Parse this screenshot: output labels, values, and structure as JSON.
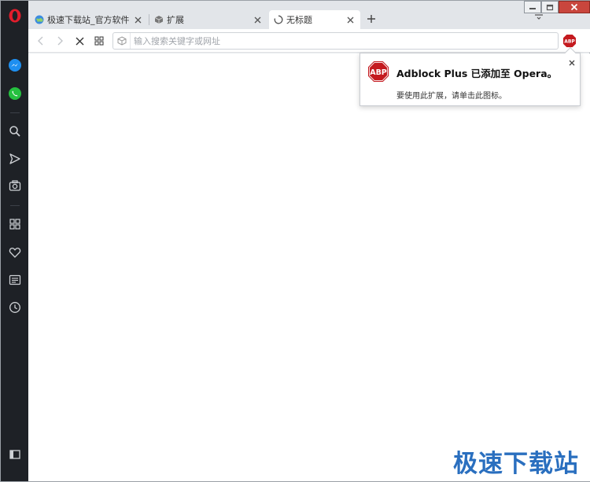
{
  "tabs": [
    {
      "title": "极速下载站_官方软件下载",
      "favicon": "globe-icon"
    },
    {
      "title": "扩展",
      "favicon": "cube-icon"
    },
    {
      "title": "无标题",
      "favicon": "loading-spinner-icon",
      "active": true
    }
  ],
  "address": {
    "value": "",
    "placeholder": "输入搜索关键字或网址"
  },
  "popup": {
    "logo_text": "ABP",
    "title": "Adblock Plus 已添加至 Opera。",
    "text": "要使用此扩展，请单击此图标。"
  },
  "toolbar_ext": {
    "label": "ABP"
  },
  "watermark": "极速下载站",
  "colors": {
    "sidebar": "#1e2126",
    "opera_red": "#e21d2c",
    "abp_red": "#c41a1f",
    "messenger_blue": "#1e8ff0",
    "whatsapp_green": "#25c03f"
  }
}
